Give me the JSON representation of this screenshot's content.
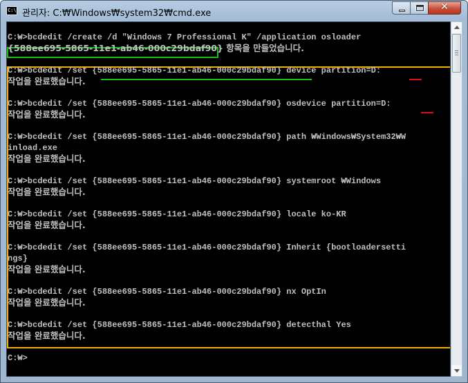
{
  "window": {
    "icon_label": "C:\\",
    "title": "관리자: C:₩Windows₩system32₩cmd.exe",
    "controls": {
      "minimize": "",
      "maximize": "",
      "close": "✕"
    }
  },
  "console": {
    "lines": [
      {
        "text": "C:₩>bcdedit /create /d \"Windows 7 Professional K\" /application osloader"
      },
      {
        "text": "{588ee695-5865-11e1-ab46-000c29bdaf90} 항목을 만들었습니다."
      },
      {
        "text": ""
      },
      {
        "text": "C:₩>bcdedit /set {588ee695-5865-11e1-ab46-000c29bdaf90} device partition=D:"
      },
      {
        "text": "작업을 완료했습니다."
      },
      {
        "text": ""
      },
      {
        "text": "C:₩>bcdedit /set {588ee695-5865-11e1-ab46-000c29bdaf90} osdevice partition=D:"
      },
      {
        "text": "작업을 완료했습니다."
      },
      {
        "text": ""
      },
      {
        "text": "C:₩>bcdedit /set {588ee695-5865-11e1-ab46-000c29bdaf90} path ₩Windows₩System32₩W"
      },
      {
        "text": "inload.exe"
      },
      {
        "text": "작업을 완료했습니다."
      },
      {
        "text": ""
      },
      {
        "text": "C:₩>bcdedit /set {588ee695-5865-11e1-ab46-000c29bdaf90} systemroot ₩Windows"
      },
      {
        "text": "작업을 완료했습니다."
      },
      {
        "text": ""
      },
      {
        "text": "C:₩>bcdedit /set {588ee695-5865-11e1-ab46-000c29bdaf90} locale ko-KR"
      },
      {
        "text": "작업을 완료했습니다."
      },
      {
        "text": ""
      },
      {
        "text": "C:₩>bcdedit /set {588ee695-5865-11e1-ab46-000c29bdaf90} Inherit {bootloadersetti"
      },
      {
        "text": "ngs}"
      },
      {
        "text": "작업을 완료했습니다."
      },
      {
        "text": ""
      },
      {
        "text": "C:₩>bcdedit /set {588ee695-5865-11e1-ab46-000c29bdaf90} nx OptIn"
      },
      {
        "text": "작업을 완료했습니다."
      },
      {
        "text": ""
      },
      {
        "text": "C:₩>bcdedit /set {588ee695-5865-11e1-ab46-000c29bdaf90} detecthal Yes"
      },
      {
        "text": "작업을 완료했습니다."
      },
      {
        "text": ""
      },
      {
        "text": "C:₩>"
      }
    ]
  },
  "colors": {
    "console_text": "#c0c0c0",
    "highlight_green": "#18c018",
    "highlight_yellow": "#f0b400",
    "underline_red": "#e01010"
  }
}
